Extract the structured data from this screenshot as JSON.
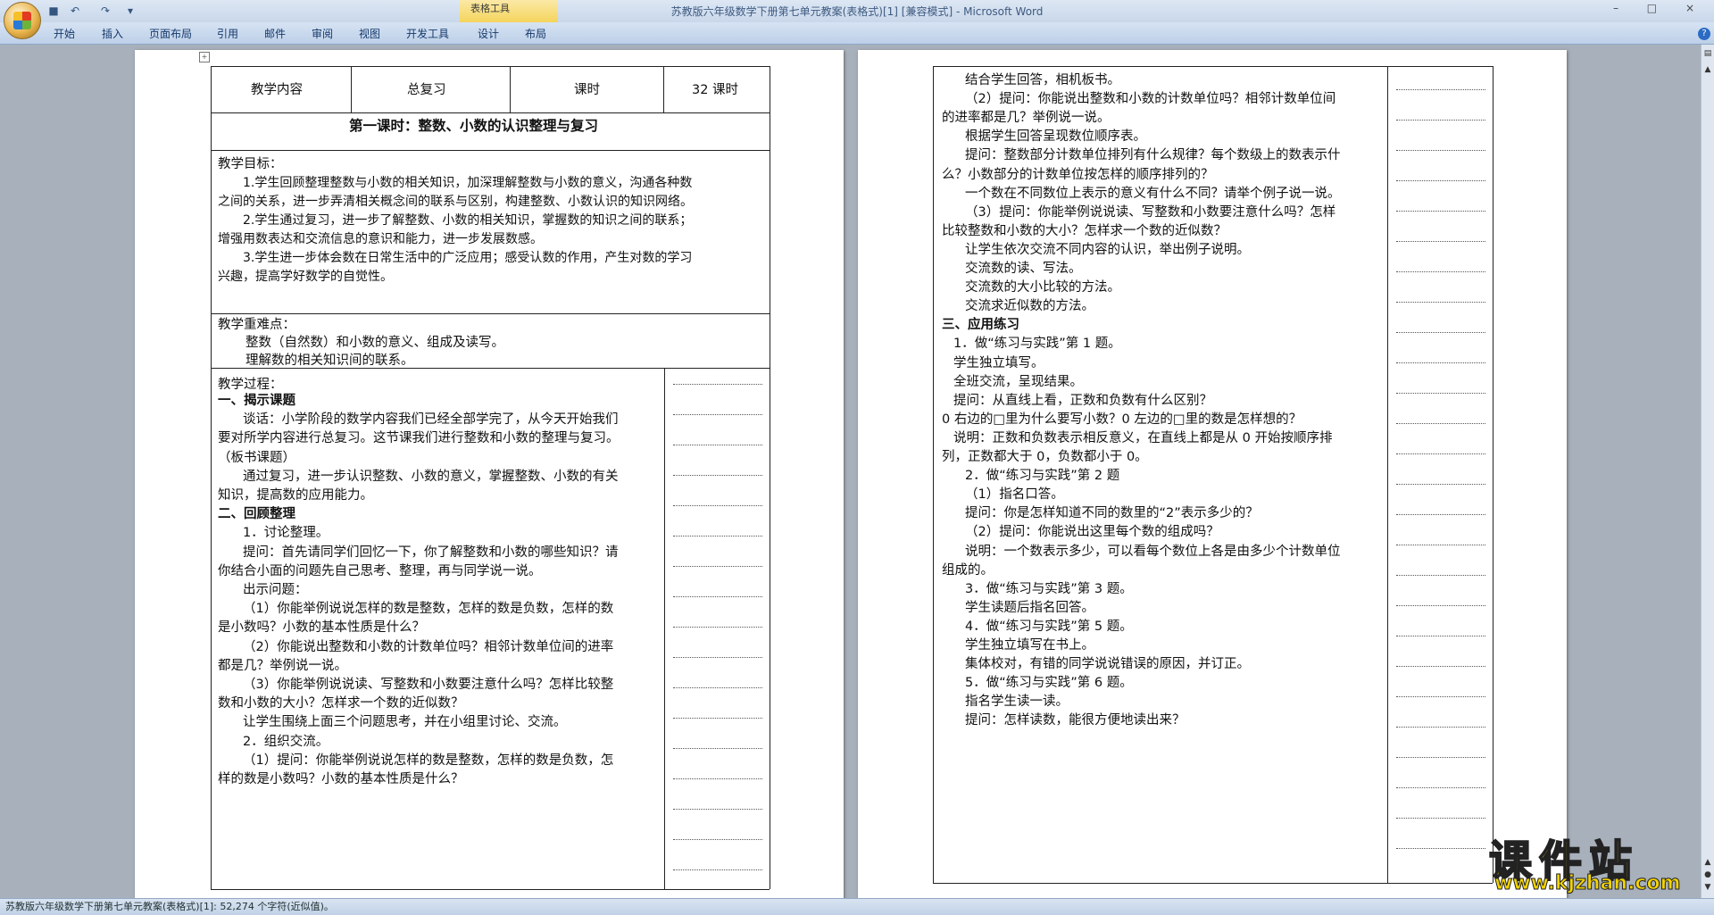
{
  "window": {
    "title": "苏教版六年级数学下册第七单元教案(表格式)[1] [兼容模式] - Microsoft Word",
    "context_tools": "表格工具",
    "controls": [
      "–",
      "□",
      "×"
    ]
  },
  "ribbon": {
    "tabs": [
      "开始",
      "插入",
      "页面布局",
      "引用",
      "邮件",
      "审阅",
      "视图",
      "开发工具",
      "设计",
      "布局"
    ]
  },
  "page1": {
    "header": [
      "教学内容",
      "总复习",
      "课时",
      "32 课时"
    ],
    "lesson_title": "第一课时：整数、小数的认识整理与复习",
    "goals_heading": "教学目标：",
    "goals": [
      "1.学生回顾整理整数与小数的相关知识，加深理解整数与小数的意义，沟通各种数",
      "之间的关系，进一步弄清相关概念间的联系与区别，构建整数、小数认识的知识网络。",
      "2.学生通过复习，进一步了解整数、小数的相关知识，掌握数的知识之间的联系；",
      "增强用数表达和交流信息的意识和能力，进一步发展数感。",
      "3.学生进一步体会数在日常生活中的广泛应用；感受认数的作用，产生对数的学习",
      "兴趣，提高学好数学的自觉性。"
    ],
    "key_heading": "教学重难点：",
    "key_points": [
      "整数（自然数）和小数的意义、组成及读写。",
      "理解数的相关知识间的联系。"
    ],
    "process_heading": "教学过程：",
    "process": [
      {
        "t": "一、揭示课题",
        "b": true,
        "i": 0
      },
      {
        "t": "谈话：小学阶段的数学内容我们已经全部学完了，从今天开始我们",
        "i": 2
      },
      {
        "t": "要对所学内容进行总复习。这节课我们进行整数和小数的整理与复习。",
        "i": 0
      },
      {
        "t": "（板书课题）",
        "i": 0
      },
      {
        "t": "通过复习，进一步认识整数、小数的意义，掌握整数、小数的有关",
        "i": 2
      },
      {
        "t": "知识，提高数的应用能力。",
        "i": 0
      },
      {
        "t": "二、回顾整理",
        "b": true,
        "i": 0
      },
      {
        "t": "1．讨论整理。",
        "i": 2
      },
      {
        "t": "提问：首先请同学们回忆一下，你了解整数和小数的哪些知识？请",
        "i": 2
      },
      {
        "t": "你结合小面的问题先自己思考、整理，再与同学说一说。",
        "i": 0
      },
      {
        "t": "出示问题：",
        "i": 2
      },
      {
        "t": "（1）你能举例说说怎样的数是整数，怎样的数是负数，怎样的数",
        "i": 2
      },
      {
        "t": "是小数吗？小数的基本性质是什么？",
        "i": 0
      },
      {
        "t": "（2）你能说出整数和小数的计数单位吗？相邻计数单位间的进率",
        "i": 2
      },
      {
        "t": "都是几？举例说一说。",
        "i": 0
      },
      {
        "t": "（3）你能举例说说读、写整数和小数要注意什么吗？怎样比较整",
        "i": 2
      },
      {
        "t": "数和小数的大小？怎样求一个数的近似数？",
        "i": 0
      },
      {
        "t": "让学生围绕上面三个问题思考，并在小组里讨论、交流。",
        "i": 2
      },
      {
        "t": "2．组织交流。",
        "i": 2
      },
      {
        "t": "（1）提问：你能举例说说怎样的数是整数，怎样的数是负数，怎",
        "i": 2
      },
      {
        "t": "样的数是小数吗？小数的基本性质是什么？",
        "i": 0
      }
    ]
  },
  "page2": {
    "lines": [
      {
        "t": "结合学生回答，相机板书。",
        "i": 2
      },
      {
        "t": "（2）提问：你能说出整数和小数的计数单位吗？相邻计数单位间",
        "i": 2
      },
      {
        "t": "的进率都是几？举例说一说。",
        "i": 0
      },
      {
        "t": "根据学生回答呈现数位顺序表。",
        "i": 2
      },
      {
        "t": "提问：整数部分计数单位排列有什么规律？每个数级上的数表示什",
        "i": 2
      },
      {
        "t": "么？小数部分的计数单位按怎样的顺序排列的？",
        "i": 0
      },
      {
        "t": "一个数在不同数位上表示的意义有什么不同？请举个例子说一说。",
        "i": 2
      },
      {
        "t": "（3）提问：你能举例说说读、写整数和小数要注意什么吗？怎样",
        "i": 2
      },
      {
        "t": "比较整数和小数的大小？怎样求一个数的近似数？",
        "i": 0
      },
      {
        "t": "让学生依次交流不同内容的认识，举出例子说明。",
        "i": 2
      },
      {
        "t": "交流数的读、写法。",
        "i": 2
      },
      {
        "t": "交流数的大小比较的方法。",
        "i": 2
      },
      {
        "t": "交流求近似数的方法。",
        "i": 2
      },
      {
        "t": "三、应用练习",
        "b": true,
        "i": 0
      },
      {
        "t": "1．做“练习与实践”第 1 题。",
        "i": 1
      },
      {
        "t": "学生独立填写。",
        "i": 1
      },
      {
        "t": "全班交流，呈现结果。",
        "i": 1
      },
      {
        "t": "提问：从直线上看，正数和负数有什么区别？",
        "i": 1
      },
      {
        "t": "0 右边的□里为什么要写小数？0 左边的□里的数是怎样想的？",
        "i": 0
      },
      {
        "t": "说明：正数和负数表示相反意义，在直线上都是从 0 开始按顺序排",
        "i": 1
      },
      {
        "t": "列，正数都大于 0，负数都小于 0。",
        "i": 0
      },
      {
        "t": "2．做“练习与实践”第 2 题",
        "i": 2
      },
      {
        "t": "（1）指名口答。",
        "i": 2
      },
      {
        "t": "提问：你是怎样知道不同的数里的“2”表示多少的？",
        "i": 2
      },
      {
        "t": "（2）提问：你能说出这里每个数的组成吗？",
        "i": 2
      },
      {
        "t": "说明：一个数表示多少，可以看每个数位上各是由多少个计数单位",
        "i": 2
      },
      {
        "t": "组成的。",
        "i": 0
      },
      {
        "t": "3．做“练习与实践”第 3 题。",
        "i": 2
      },
      {
        "t": "学生读题后指名回答。",
        "i": 2
      },
      {
        "t": "4．做“练习与实践”第 5 题。",
        "i": 2
      },
      {
        "t": "学生独立填写在书上。",
        "i": 2
      },
      {
        "t": "集体校对，有错的同学说说错误的原因，并订正。",
        "i": 2
      },
      {
        "t": "5．做“练习与实践”第 6 题。",
        "i": 2
      },
      {
        "t": "指名学生读一读。",
        "i": 2
      },
      {
        "t": "提问：怎样读数，能很方便地读出来？",
        "i": 2
      }
    ]
  },
  "status": {
    "text": "苏教版六年级数学下册第七单元教案(表格式)[1]: 52,274 个字符(近似值)。"
  },
  "watermark": {
    "title": "课件站",
    "url": "www.kjzhan.com"
  }
}
